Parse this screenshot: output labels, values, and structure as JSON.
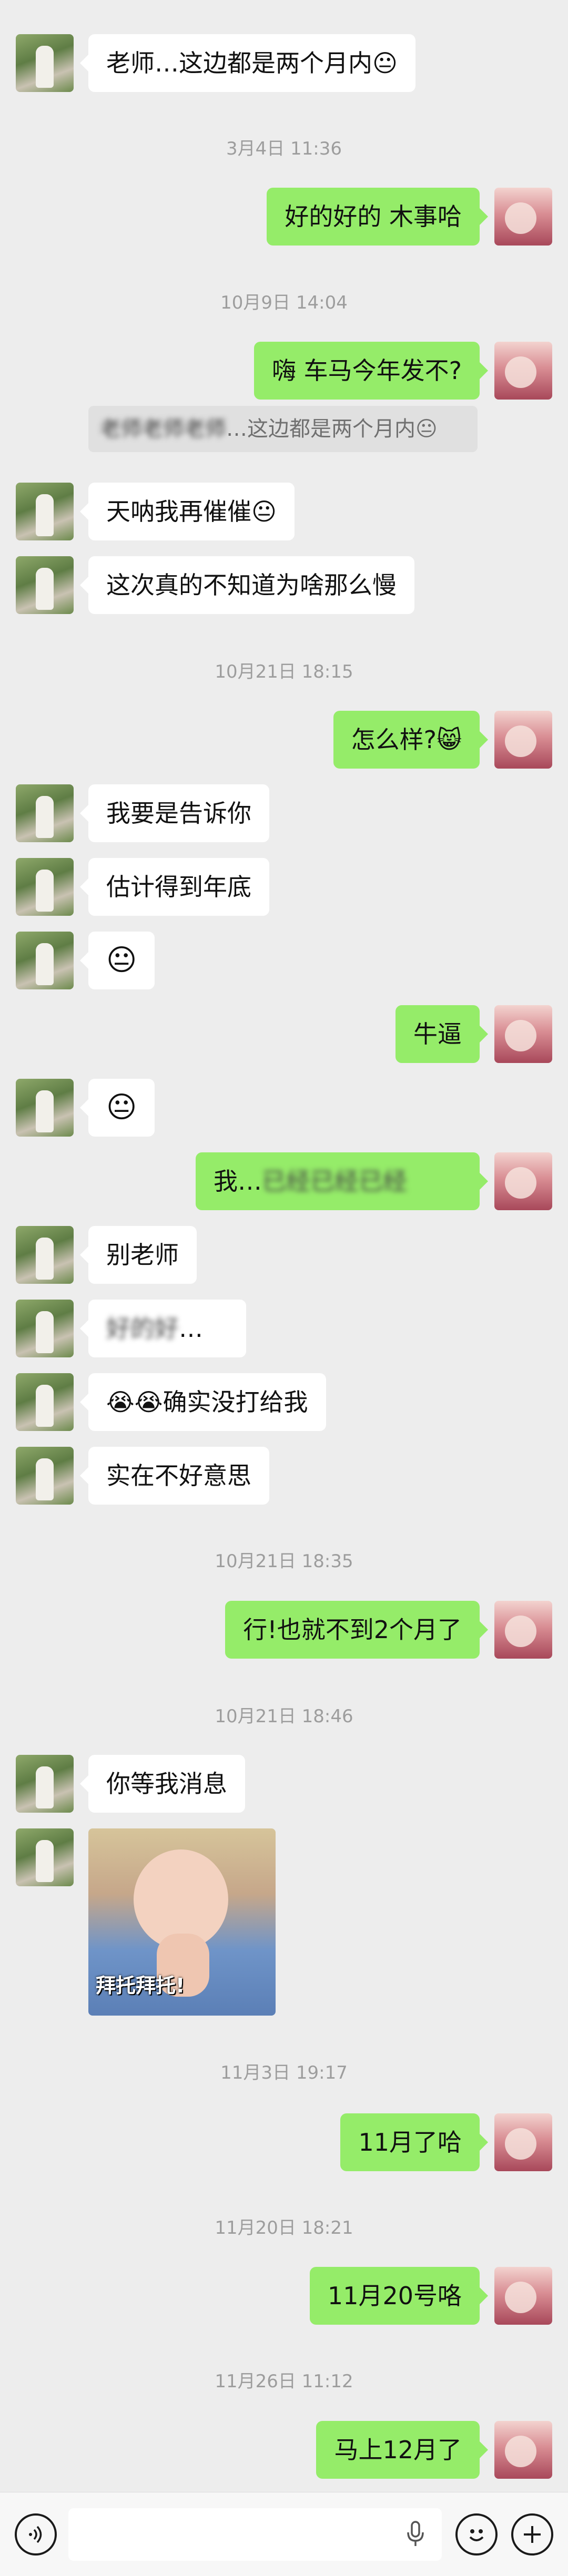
{
  "messages": [
    {
      "type": "other",
      "text": "老师…这边都是两个月内😐"
    },
    {
      "type": "time",
      "text": "3月4日 11:36"
    },
    {
      "type": "self",
      "text": "好的好的 木事哈"
    },
    {
      "type": "time",
      "text": "10月9日 14:04"
    },
    {
      "type": "self",
      "text": "嗨 车马今年发不?"
    },
    {
      "type": "quote",
      "text": "…这边都是两个月内😐"
    },
    {
      "type": "other",
      "text": "天呐我再催催😐"
    },
    {
      "type": "other",
      "text": "这次真的不知道为啥那么慢"
    },
    {
      "type": "time",
      "text": "10月21日 18:15"
    },
    {
      "type": "self",
      "text": "怎么样?😸"
    },
    {
      "type": "other",
      "text": "我要是告诉你"
    },
    {
      "type": "other",
      "text": "估计得到年底"
    },
    {
      "type": "other",
      "text": "😐"
    },
    {
      "type": "self",
      "text": "牛逼"
    },
    {
      "type": "other",
      "text": "😐"
    },
    {
      "type": "self",
      "text": "我…"
    },
    {
      "type": "other",
      "text": "别老师"
    },
    {
      "type": "other",
      "text": "…"
    },
    {
      "type": "other",
      "text": "😭😭确实没打给我"
    },
    {
      "type": "other",
      "text": "实在不好意思"
    },
    {
      "type": "time",
      "text": "10月21日 18:35"
    },
    {
      "type": "self",
      "text": "行!也就不到2个月了"
    },
    {
      "type": "time",
      "text": "10月21日 18:46"
    },
    {
      "type": "other",
      "text": "你等我消息"
    },
    {
      "type": "sticker",
      "text": "拜托拜托!"
    },
    {
      "type": "time",
      "text": "11月3日 19:17"
    },
    {
      "type": "self",
      "text": "11月了哈"
    },
    {
      "type": "time",
      "text": "11月20日 18:21"
    },
    {
      "type": "self",
      "text": "11月20号咯"
    },
    {
      "type": "time",
      "text": "11月26日 11:12"
    },
    {
      "type": "self",
      "text": "马上12月了"
    }
  ],
  "input": {
    "placeholder": ""
  },
  "icons": {
    "voice": "voice-icon",
    "mic": "mic-icon",
    "emoji": "emoji-icon",
    "plus": "plus-icon"
  },
  "colors": {
    "self_bubble": "#95ec69",
    "other_bubble": "#ffffff",
    "background": "#ededed"
  }
}
